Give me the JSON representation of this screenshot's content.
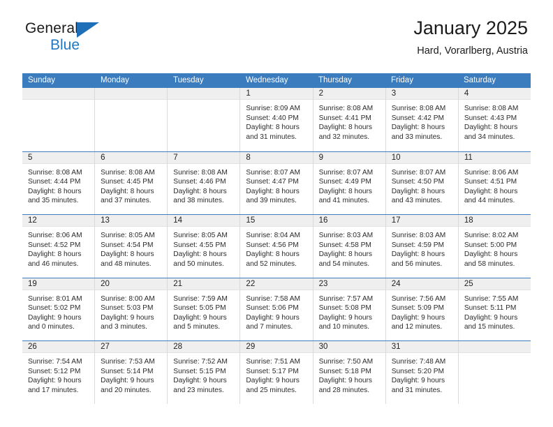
{
  "brand": {
    "word_top": "General",
    "word_bottom": "Blue",
    "accent_color": "#1f6fb8"
  },
  "header": {
    "title": "January 2025",
    "subtitle": "Hard, Vorarlberg, Austria"
  },
  "theme": {
    "header_blue": "#3a7cbd",
    "daynum_band": "#efefef",
    "cell_border": "#d9d9d9"
  },
  "weekday_headers": [
    "Sunday",
    "Monday",
    "Tuesday",
    "Wednesday",
    "Thursday",
    "Friday",
    "Saturday"
  ],
  "weeks": [
    [
      {
        "day": "",
        "l1": "",
        "l2": "",
        "l3": "",
        "l4": ""
      },
      {
        "day": "",
        "l1": "",
        "l2": "",
        "l3": "",
        "l4": ""
      },
      {
        "day": "",
        "l1": "",
        "l2": "",
        "l3": "",
        "l4": ""
      },
      {
        "day": "1",
        "l1": "Sunrise: 8:09 AM",
        "l2": "Sunset: 4:40 PM",
        "l3": "Daylight: 8 hours",
        "l4": "and 31 minutes."
      },
      {
        "day": "2",
        "l1": "Sunrise: 8:08 AM",
        "l2": "Sunset: 4:41 PM",
        "l3": "Daylight: 8 hours",
        "l4": "and 32 minutes."
      },
      {
        "day": "3",
        "l1": "Sunrise: 8:08 AM",
        "l2": "Sunset: 4:42 PM",
        "l3": "Daylight: 8 hours",
        "l4": "and 33 minutes."
      },
      {
        "day": "4",
        "l1": "Sunrise: 8:08 AM",
        "l2": "Sunset: 4:43 PM",
        "l3": "Daylight: 8 hours",
        "l4": "and 34 minutes."
      }
    ],
    [
      {
        "day": "5",
        "l1": "Sunrise: 8:08 AM",
        "l2": "Sunset: 4:44 PM",
        "l3": "Daylight: 8 hours",
        "l4": "and 35 minutes."
      },
      {
        "day": "6",
        "l1": "Sunrise: 8:08 AM",
        "l2": "Sunset: 4:45 PM",
        "l3": "Daylight: 8 hours",
        "l4": "and 37 minutes."
      },
      {
        "day": "7",
        "l1": "Sunrise: 8:08 AM",
        "l2": "Sunset: 4:46 PM",
        "l3": "Daylight: 8 hours",
        "l4": "and 38 minutes."
      },
      {
        "day": "8",
        "l1": "Sunrise: 8:07 AM",
        "l2": "Sunset: 4:47 PM",
        "l3": "Daylight: 8 hours",
        "l4": "and 39 minutes."
      },
      {
        "day": "9",
        "l1": "Sunrise: 8:07 AM",
        "l2": "Sunset: 4:49 PM",
        "l3": "Daylight: 8 hours",
        "l4": "and 41 minutes."
      },
      {
        "day": "10",
        "l1": "Sunrise: 8:07 AM",
        "l2": "Sunset: 4:50 PM",
        "l3": "Daylight: 8 hours",
        "l4": "and 43 minutes."
      },
      {
        "day": "11",
        "l1": "Sunrise: 8:06 AM",
        "l2": "Sunset: 4:51 PM",
        "l3": "Daylight: 8 hours",
        "l4": "and 44 minutes."
      }
    ],
    [
      {
        "day": "12",
        "l1": "Sunrise: 8:06 AM",
        "l2": "Sunset: 4:52 PM",
        "l3": "Daylight: 8 hours",
        "l4": "and 46 minutes."
      },
      {
        "day": "13",
        "l1": "Sunrise: 8:05 AM",
        "l2": "Sunset: 4:54 PM",
        "l3": "Daylight: 8 hours",
        "l4": "and 48 minutes."
      },
      {
        "day": "14",
        "l1": "Sunrise: 8:05 AM",
        "l2": "Sunset: 4:55 PM",
        "l3": "Daylight: 8 hours",
        "l4": "and 50 minutes."
      },
      {
        "day": "15",
        "l1": "Sunrise: 8:04 AM",
        "l2": "Sunset: 4:56 PM",
        "l3": "Daylight: 8 hours",
        "l4": "and 52 minutes."
      },
      {
        "day": "16",
        "l1": "Sunrise: 8:03 AM",
        "l2": "Sunset: 4:58 PM",
        "l3": "Daylight: 8 hours",
        "l4": "and 54 minutes."
      },
      {
        "day": "17",
        "l1": "Sunrise: 8:03 AM",
        "l2": "Sunset: 4:59 PM",
        "l3": "Daylight: 8 hours",
        "l4": "and 56 minutes."
      },
      {
        "day": "18",
        "l1": "Sunrise: 8:02 AM",
        "l2": "Sunset: 5:00 PM",
        "l3": "Daylight: 8 hours",
        "l4": "and 58 minutes."
      }
    ],
    [
      {
        "day": "19",
        "l1": "Sunrise: 8:01 AM",
        "l2": "Sunset: 5:02 PM",
        "l3": "Daylight: 9 hours",
        "l4": "and 0 minutes."
      },
      {
        "day": "20",
        "l1": "Sunrise: 8:00 AM",
        "l2": "Sunset: 5:03 PM",
        "l3": "Daylight: 9 hours",
        "l4": "and 3 minutes."
      },
      {
        "day": "21",
        "l1": "Sunrise: 7:59 AM",
        "l2": "Sunset: 5:05 PM",
        "l3": "Daylight: 9 hours",
        "l4": "and 5 minutes."
      },
      {
        "day": "22",
        "l1": "Sunrise: 7:58 AM",
        "l2": "Sunset: 5:06 PM",
        "l3": "Daylight: 9 hours",
        "l4": "and 7 minutes."
      },
      {
        "day": "23",
        "l1": "Sunrise: 7:57 AM",
        "l2": "Sunset: 5:08 PM",
        "l3": "Daylight: 9 hours",
        "l4": "and 10 minutes."
      },
      {
        "day": "24",
        "l1": "Sunrise: 7:56 AM",
        "l2": "Sunset: 5:09 PM",
        "l3": "Daylight: 9 hours",
        "l4": "and 12 minutes."
      },
      {
        "day": "25",
        "l1": "Sunrise: 7:55 AM",
        "l2": "Sunset: 5:11 PM",
        "l3": "Daylight: 9 hours",
        "l4": "and 15 minutes."
      }
    ],
    [
      {
        "day": "26",
        "l1": "Sunrise: 7:54 AM",
        "l2": "Sunset: 5:12 PM",
        "l3": "Daylight: 9 hours",
        "l4": "and 17 minutes."
      },
      {
        "day": "27",
        "l1": "Sunrise: 7:53 AM",
        "l2": "Sunset: 5:14 PM",
        "l3": "Daylight: 9 hours",
        "l4": "and 20 minutes."
      },
      {
        "day": "28",
        "l1": "Sunrise: 7:52 AM",
        "l2": "Sunset: 5:15 PM",
        "l3": "Daylight: 9 hours",
        "l4": "and 23 minutes."
      },
      {
        "day": "29",
        "l1": "Sunrise: 7:51 AM",
        "l2": "Sunset: 5:17 PM",
        "l3": "Daylight: 9 hours",
        "l4": "and 25 minutes."
      },
      {
        "day": "30",
        "l1": "Sunrise: 7:50 AM",
        "l2": "Sunset: 5:18 PM",
        "l3": "Daylight: 9 hours",
        "l4": "and 28 minutes."
      },
      {
        "day": "31",
        "l1": "Sunrise: 7:48 AM",
        "l2": "Sunset: 5:20 PM",
        "l3": "Daylight: 9 hours",
        "l4": "and 31 minutes."
      },
      {
        "day": "",
        "l1": "",
        "l2": "",
        "l3": "",
        "l4": ""
      }
    ]
  ]
}
